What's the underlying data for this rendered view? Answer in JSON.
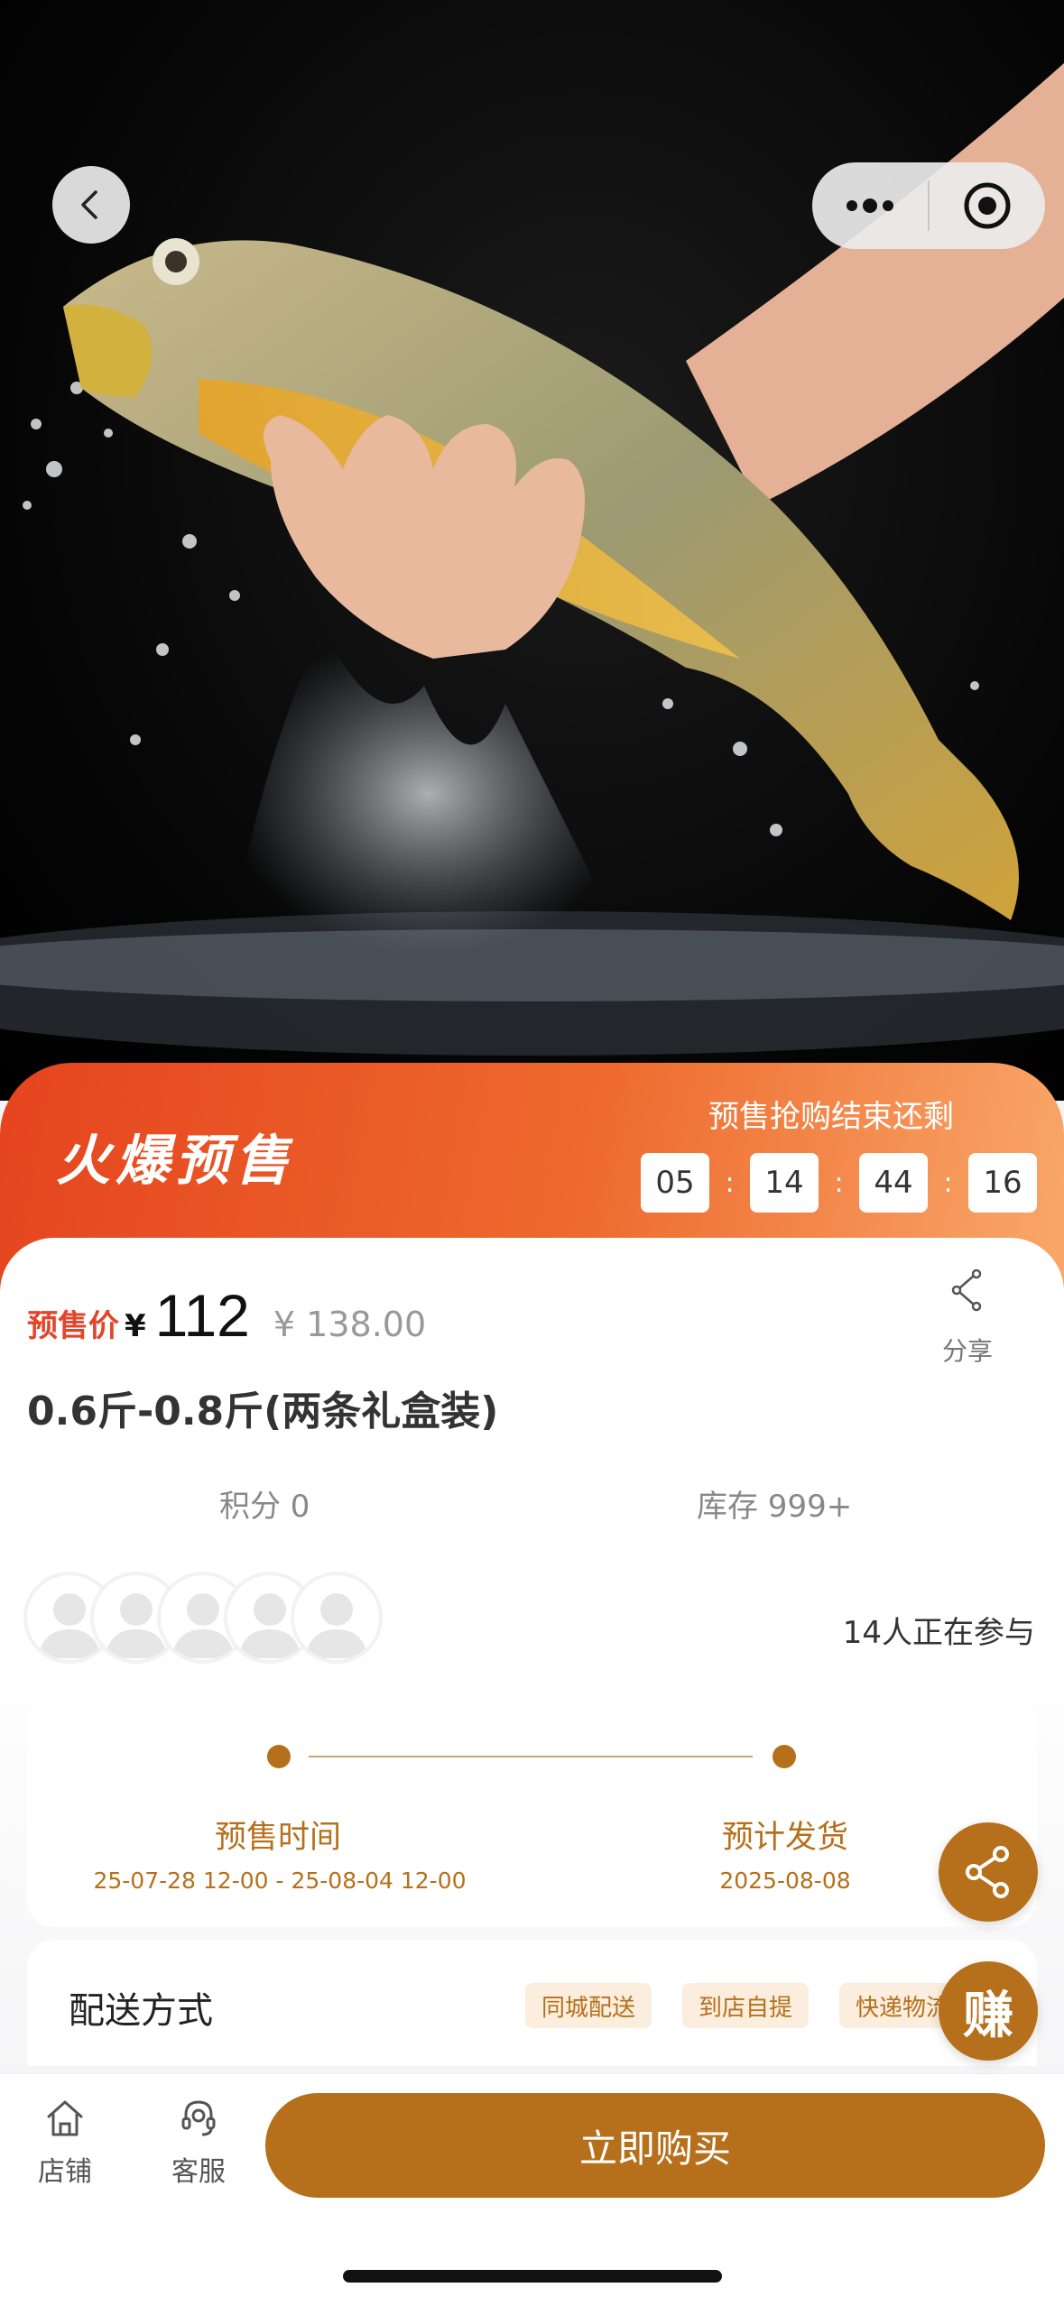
{
  "banner": {
    "title": "火爆预售",
    "countdown_label": "预售抢购结束还剩",
    "countdown": [
      "05",
      "14",
      "44",
      "16"
    ]
  },
  "price": {
    "label": "预售价",
    "currency": "¥",
    "value": "112",
    "original": "¥ 138.00"
  },
  "share_label": "分享",
  "product_name": "0.6斤-0.8斤(两条礼盒装)",
  "stats": {
    "points": "积分 0",
    "stock": "库存 999+"
  },
  "participants": {
    "text": "14人正在参与",
    "avatar_count": 5
  },
  "timeline": {
    "start_title": "预售时间",
    "start_date": "25-07-28 12-00 - 25-08-04 12-00",
    "ship_title": "预计发货",
    "ship_date": "2025-08-08"
  },
  "delivery": {
    "title": "配送方式",
    "tags": [
      "同城配送",
      "到店自提",
      "快递物流"
    ]
  },
  "fab": {
    "earn_label": "赚"
  },
  "bottom": {
    "store": "店铺",
    "service": "客服",
    "buy": "立即购买"
  },
  "colors": {
    "accent": "#b6701b",
    "price_red": "#e2452a",
    "banner_start": "#e5441e",
    "banner_end": "#f9a86a"
  },
  "icons": {
    "back": "chevron-left-icon",
    "more": "more-dots-icon",
    "close": "target-circle-icon",
    "share": "share-icon",
    "store": "home-icon",
    "service": "headset-icon"
  }
}
